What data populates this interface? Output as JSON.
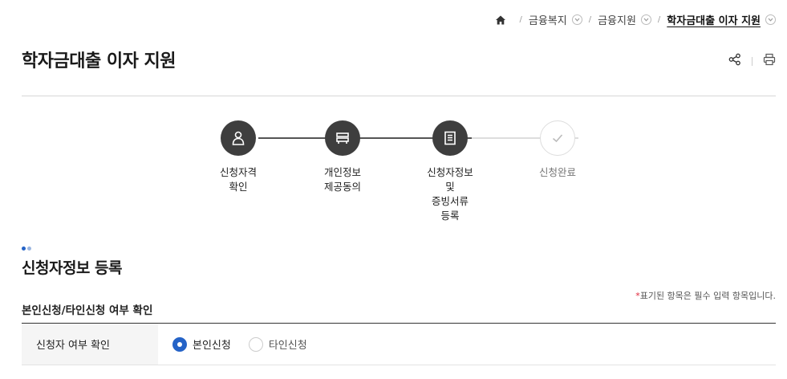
{
  "breadcrumb": {
    "home_icon": "home-icon",
    "items": [
      "금융복지",
      "금융지원",
      "학자금대출 이자 지원"
    ],
    "separator": "/"
  },
  "page": {
    "title": "학자금대출 이자 지원",
    "share_icon": "share-icon",
    "print_icon": "print-icon"
  },
  "steps": [
    {
      "label": "신청자격\n확인",
      "icon": "person-icon",
      "active": true
    },
    {
      "label": "개인정보\n제공동의",
      "icon": "document-stack-icon",
      "active": true
    },
    {
      "label": "신청자정보\n및\n증빙서류\n등록",
      "icon": "list-document-icon",
      "active": true
    },
    {
      "label": "신청완료",
      "icon": "check-icon",
      "active": false
    }
  ],
  "section": {
    "title": "신청자정보 등록",
    "dot_colors": [
      "#2563c7",
      "#9bb6e0"
    ],
    "required_star": "*",
    "required_note": "표기된 항목은 필수 입력 항목입니다.",
    "subtitle": "본인신청/타인신청 여부 확인"
  },
  "form": {
    "row_label": "신청자 여부 확인",
    "options": [
      {
        "label": "본인신청",
        "selected": true
      },
      {
        "label": "타인신청",
        "selected": false
      }
    ]
  },
  "colors": {
    "accent": "#2563c7",
    "step_active": "#3e3e3e",
    "required": "#e0253a"
  }
}
